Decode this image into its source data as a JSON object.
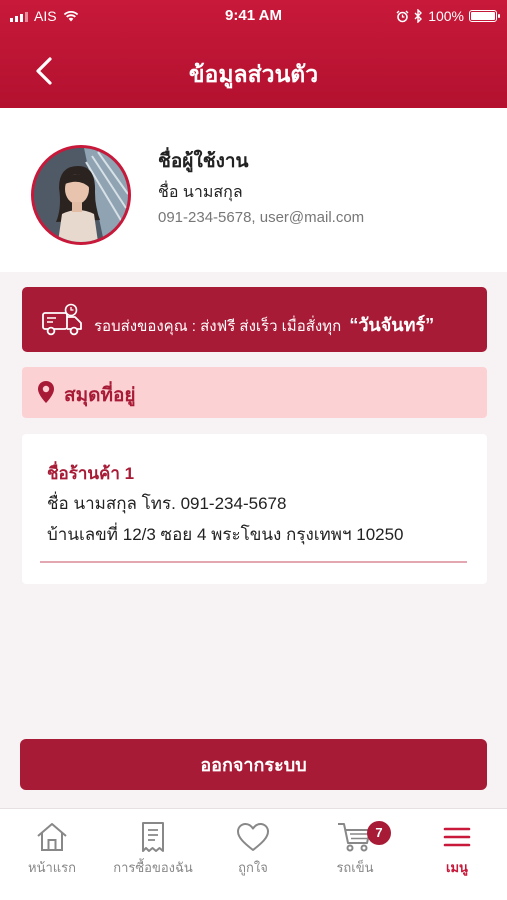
{
  "status_bar": {
    "carrier": "AIS",
    "time": "9:41 AM",
    "battery": "100%"
  },
  "header": {
    "title": "ข้อมูลส่วนตัว"
  },
  "profile": {
    "username": "ชื่อผู้ใช้งาน",
    "full_name": "ชื่อ นามสกุล",
    "contact": "091-234-5678,  user@mail.com"
  },
  "promo": {
    "text": "รอบส่งของคุณ : ส่งฟรี ส่งเร็ว เมื่อสั่งทุก",
    "day": "“วันจันทร์”"
  },
  "address_book": {
    "title": "สมุดที่อยู่",
    "entries": [
      {
        "shop_name": "ชื่อร้านค้า 1",
        "contact_line": "ชื่อ นามสกุล  โทร. 091-234-5678",
        "address_line": "บ้านเลขที่ 12/3 ซอย 4 พระโขนง กรุงเทพฯ 10250"
      }
    ]
  },
  "logout_label": "ออกจากระบบ",
  "tabbar": {
    "tabs": [
      {
        "label": "หน้าแรก",
        "icon": "home-icon"
      },
      {
        "label": "การซื้อของฉัน",
        "icon": "receipt-icon"
      },
      {
        "label": "ถูกใจ",
        "icon": "heart-icon"
      },
      {
        "label": "รถเข็น",
        "icon": "cart-icon",
        "badge": "7"
      },
      {
        "label": "เมนู",
        "icon": "menu-icon",
        "active": true
      }
    ]
  },
  "colors": {
    "primary": "#a81b36",
    "header": "#c8193a",
    "address_header_bg": "#fcd1d4"
  }
}
